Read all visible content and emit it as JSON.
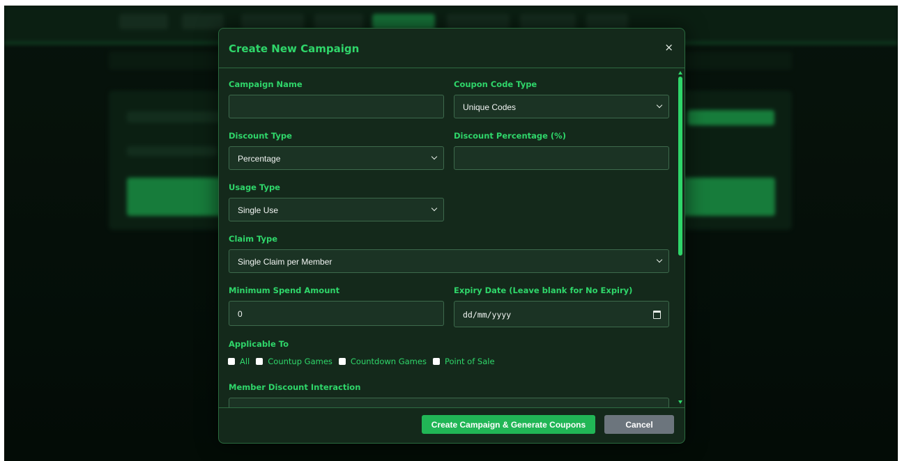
{
  "modal": {
    "title": "Create New Campaign",
    "close_label": "×"
  },
  "form": {
    "campaign_name": {
      "label": "Campaign Name",
      "value": ""
    },
    "coupon_code_type": {
      "label": "Coupon Code Type",
      "value": "Unique Codes"
    },
    "discount_type": {
      "label": "Discount Type",
      "value": "Percentage"
    },
    "discount_percentage": {
      "label": "Discount Percentage (%)",
      "value": ""
    },
    "usage_type": {
      "label": "Usage Type",
      "value": "Single Use"
    },
    "claim_type": {
      "label": "Claim Type",
      "value": "Single Claim per Member"
    },
    "minimum_spend": {
      "label": "Minimum Spend Amount",
      "value": "0"
    },
    "expiry_date": {
      "label": "Expiry Date (Leave blank for No Expiry)",
      "value": "dd/mm/yyyy"
    },
    "applicable_to": {
      "label": "Applicable To",
      "options": [
        "All",
        "Countup Games",
        "Countdown Games",
        "Point of Sale"
      ]
    },
    "member_discount_interaction": {
      "label": "Member Discount Interaction"
    }
  },
  "footer": {
    "primary_label": "Create Campaign & Generate Coupons",
    "cancel_label": "Cancel"
  },
  "colors": {
    "accent": "#2fd66a",
    "primary_button": "#21b656",
    "cancel_button": "#6c757d",
    "modal_bg": "#14291b"
  }
}
